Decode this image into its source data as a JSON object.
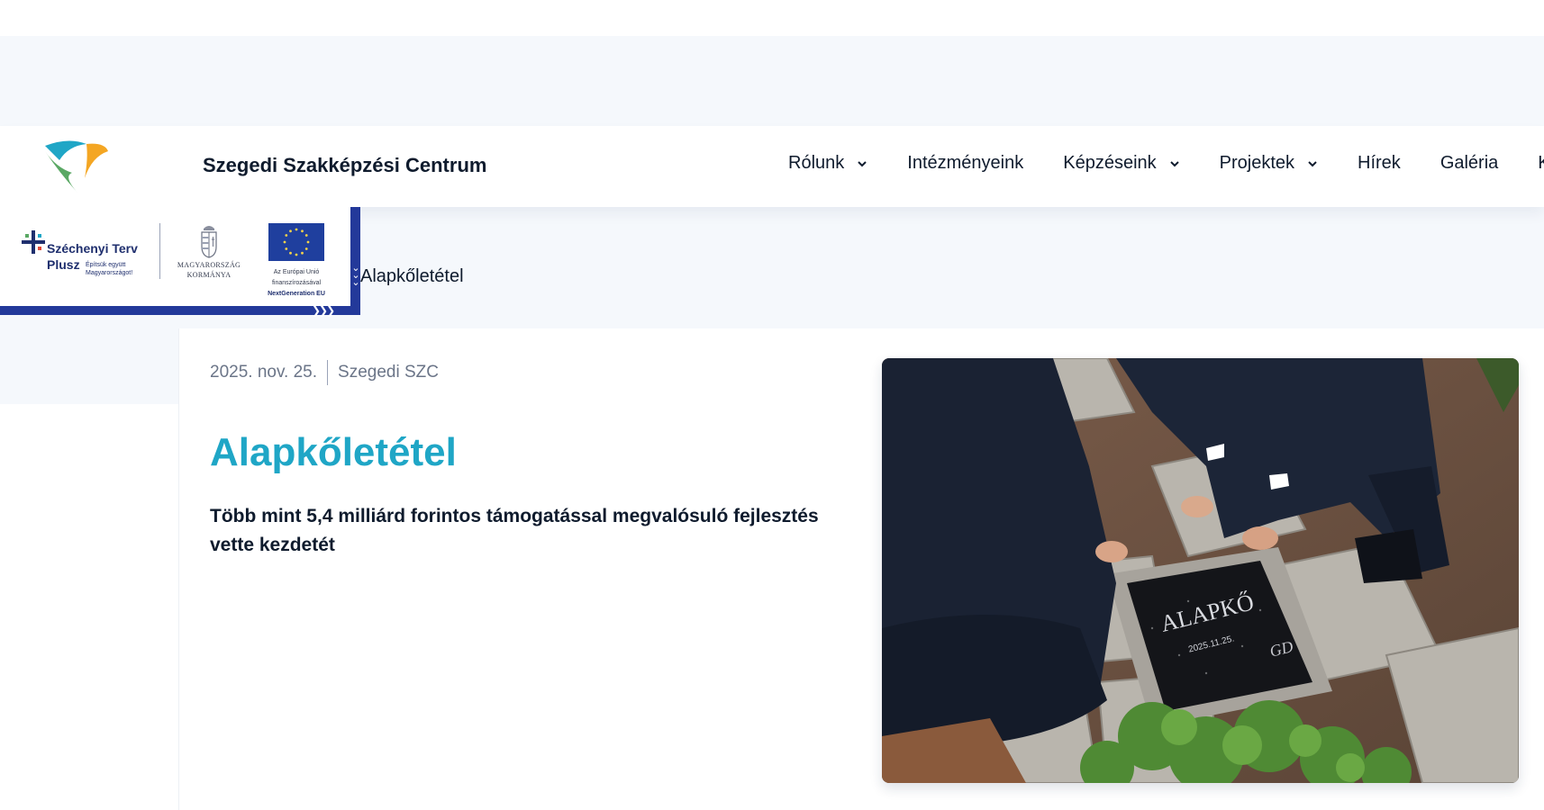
{
  "header": {
    "site_title": "Szegedi Szakképzési Centrum",
    "nav": [
      {
        "label": "Rólunk",
        "has_dropdown": true
      },
      {
        "label": "Intézményeink",
        "has_dropdown": false
      },
      {
        "label": "Képzéseink",
        "has_dropdown": true
      },
      {
        "label": "Projektek",
        "has_dropdown": true
      },
      {
        "label": "Hírek",
        "has_dropdown": false
      },
      {
        "label": "Galéria",
        "has_dropdown": false
      },
      {
        "label": "Kö",
        "has_dropdown": false
      }
    ]
  },
  "badge": {
    "szechenyi_line1": "Széchenyi Terv",
    "szechenyi_line2": "Plusz",
    "szechenyi_tagline": "Építsük együtt Magyarországot!",
    "gov_line1": "MAGYARORSZÁG",
    "gov_line2": "KORMÁNYA",
    "eu_line1": "Az Európai Unió",
    "eu_line2": "finanszírozásával",
    "eu_line3": "NextGeneration EU"
  },
  "breadcrumb": {
    "current": "Alapkőletétel"
  },
  "article": {
    "date": "2025. nov. 25.",
    "author": "Szegedi SZC",
    "title": "Alapkőletétel",
    "lede": "Több mint 5,4 milliárd forintos támogatással megvalósuló fejlesztés vette kezdetét",
    "image": {
      "stone_text": "ALAPKŐ",
      "stone_date": "2025.11.25.",
      "stone_signature": "GD"
    }
  },
  "colors": {
    "title_accent": "#1fa6c6",
    "navy": "#23399a",
    "text": "#0f1b2d",
    "muted": "#6b7588",
    "band_bg": "#f5f8fc"
  },
  "icons": [
    "szsc-logo-icon",
    "chevron-down-icon",
    "szechenyi-cross-icon",
    "hungarian-crest-icon",
    "eu-flag-icon"
  ]
}
